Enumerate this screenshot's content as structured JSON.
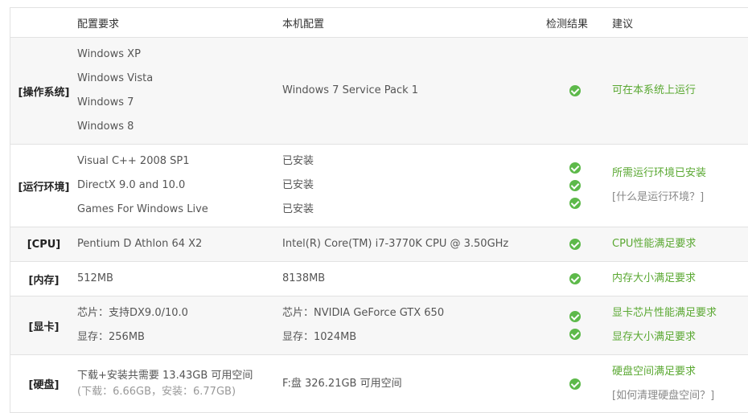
{
  "header": {
    "col_req": "配置要求",
    "col_local": "本机配置",
    "col_result": "检测结果",
    "col_suggest": "建议"
  },
  "rows": {
    "os": {
      "category": "[操作系统]",
      "req": [
        "Windows XP",
        "Windows Vista",
        "Windows 7",
        "Windows 8"
      ],
      "local": "Windows 7 Service Pack 1",
      "suggest": "可在本系统上运行"
    },
    "runtime": {
      "category": "[运行环境]",
      "req": [
        "Visual C++ 2008 SP1",
        "DirectX 9.0 and 10.0",
        "Games For Windows Live"
      ],
      "local": [
        "已安装",
        "已安装",
        "已安装"
      ],
      "suggest": "所需运行环境已安装",
      "help_link": "[什么是运行环境？]"
    },
    "cpu": {
      "category": "[CPU]",
      "req": "Pentium D Athlon 64 X2",
      "local": "Intel(R) Core(TM) i7-3770K CPU @ 3.50GHz",
      "suggest": "CPU性能满足要求"
    },
    "memory": {
      "category": "[内存]",
      "req": "512MB",
      "local": "8138MB",
      "suggest": "内存大小满足要求"
    },
    "gpu": {
      "category": "[显卡]",
      "req": [
        "芯片：支持DX9.0/10.0",
        "显存：256MB"
      ],
      "local": [
        "芯片：NVIDIA GeForce GTX 650",
        "显存：1024MB"
      ],
      "suggest": [
        "显卡芯片性能满足要求",
        "显存大小满足要求"
      ]
    },
    "disk": {
      "category": "[硬盘]",
      "req": "下载+安装共需要  13.43GB 可用空间",
      "req_sub": "(下载：6.66GB，安装：6.77GB)",
      "local": "F:盘  326.21GB 可用空间",
      "suggest": "硬盘空间满足要求",
      "help_link": "[如何清理硬盘空间？]"
    }
  },
  "icons": {
    "pass": "check-circle-icon"
  },
  "colors": {
    "pass_green": "#5db94a",
    "suggest_green": "#5aa832",
    "alt_row_bg": "#f7f7f7",
    "border": "#e2e2e2"
  }
}
